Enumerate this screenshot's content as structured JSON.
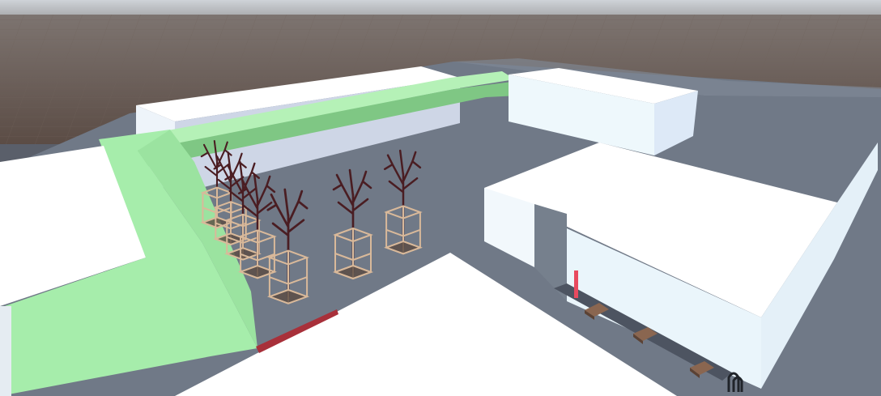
{
  "scene": {
    "view": "3d-perspective-game-scene",
    "colors": {
      "sky": "#c8cdd3",
      "horizon_haze": "#a7abaf",
      "ground_far": "#5e5048",
      "grid_line": "#6d6058",
      "ground_plane": "#6f7886",
      "building_white": "#ffffff",
      "building_side": "#e8f2f8",
      "green_path": "#aef0b0",
      "green_dark": "#78c27c",
      "tree_trunk": "#4a1d22",
      "cage_wood": "#d9b99a",
      "red_marker": "#e84a5f"
    },
    "icons": [
      "tree-model",
      "wooden-cage",
      "red-marker-post",
      "crate-model",
      "bicycle-rack"
    ]
  }
}
